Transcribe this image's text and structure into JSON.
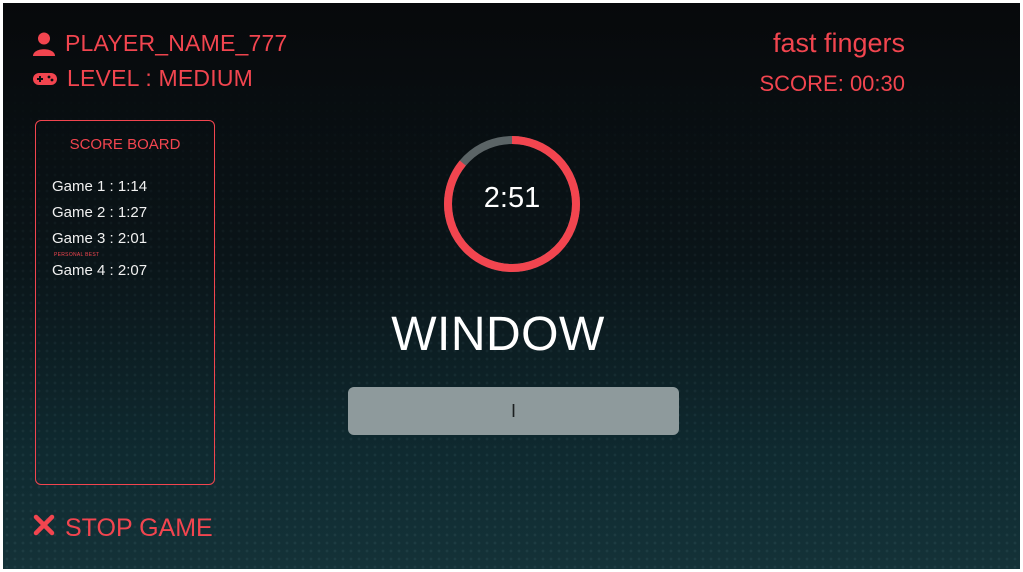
{
  "player": {
    "name": "PLAYER_NAME_777",
    "icon": "user-icon"
  },
  "level": {
    "text": "LEVEL : MEDIUM",
    "icon": "gamepad-icon"
  },
  "header": {
    "app_title": "fast fingers",
    "score": "SCORE: 00:30"
  },
  "scoreboard": {
    "title": "SCORE BOARD",
    "games": [
      {
        "label": "Game 1  : 1:14"
      },
      {
        "label": "Game 2 : 1:27"
      },
      {
        "label": "Game 3 : 2:01"
      },
      {
        "label": "Game 4 : 2:07"
      }
    ],
    "badge": "PERSONAL BEST"
  },
  "timer": {
    "text": "2:51",
    "remaining_fraction": 0.86
  },
  "word": {
    "text": "WINDOW"
  },
  "input": {
    "value": "I"
  },
  "stop": {
    "label": "STOP GAME",
    "icon": "close-icon"
  },
  "colors": {
    "accent": "#f2454f",
    "track": "#5b6466",
    "input_bg": "#8e9a9c",
    "text": "#ffffff"
  }
}
